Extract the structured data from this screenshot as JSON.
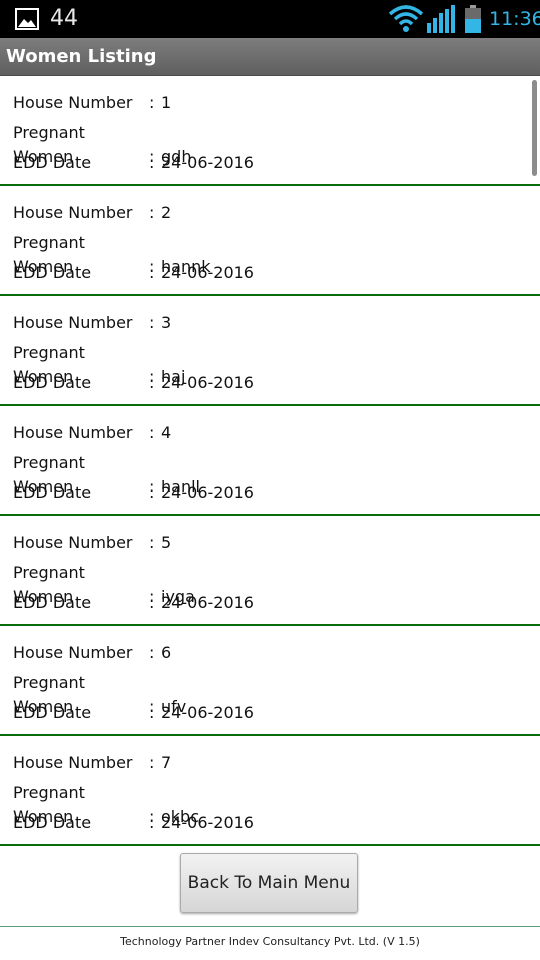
{
  "status_bar": {
    "notification_count": "44",
    "time": "11:36",
    "icons": [
      "gallery-icon",
      "wifi-icon",
      "signal-icon",
      "battery-icon"
    ]
  },
  "title_bar": {
    "title": "Women Listing"
  },
  "labels": {
    "house_number": "House Number",
    "pregnant_women": "Pregnant Women",
    "edd_date": "EDD Date",
    "separator": ":"
  },
  "records": [
    {
      "house_number": "1",
      "pregnant_women": "gdh",
      "edd_date": "24-06-2016"
    },
    {
      "house_number": "2",
      "pregnant_women": "hannk",
      "edd_date": "24-06-2016"
    },
    {
      "house_number": "3",
      "pregnant_women": "haj",
      "edd_date": "24-06-2016"
    },
    {
      "house_number": "4",
      "pregnant_women": "hanll",
      "edd_date": "24-06-2016"
    },
    {
      "house_number": "5",
      "pregnant_women": "iyga",
      "edd_date": "24-06-2016"
    },
    {
      "house_number": "6",
      "pregnant_women": "ufv",
      "edd_date": "24-06-2016"
    },
    {
      "house_number": "7",
      "pregnant_women": "okbc",
      "edd_date": "24-06-2016"
    }
  ],
  "back_button": {
    "label": "Back To Main Menu"
  },
  "footer": {
    "text": "Technology Partner Indev Consultancy Pvt. Ltd. (V 1.5)"
  },
  "colors": {
    "status_bar_bg": "#000000",
    "title_bar_bg": "#6e6e6e",
    "divider": "#0a6b0a",
    "clock_accent": "#33b5e5"
  }
}
